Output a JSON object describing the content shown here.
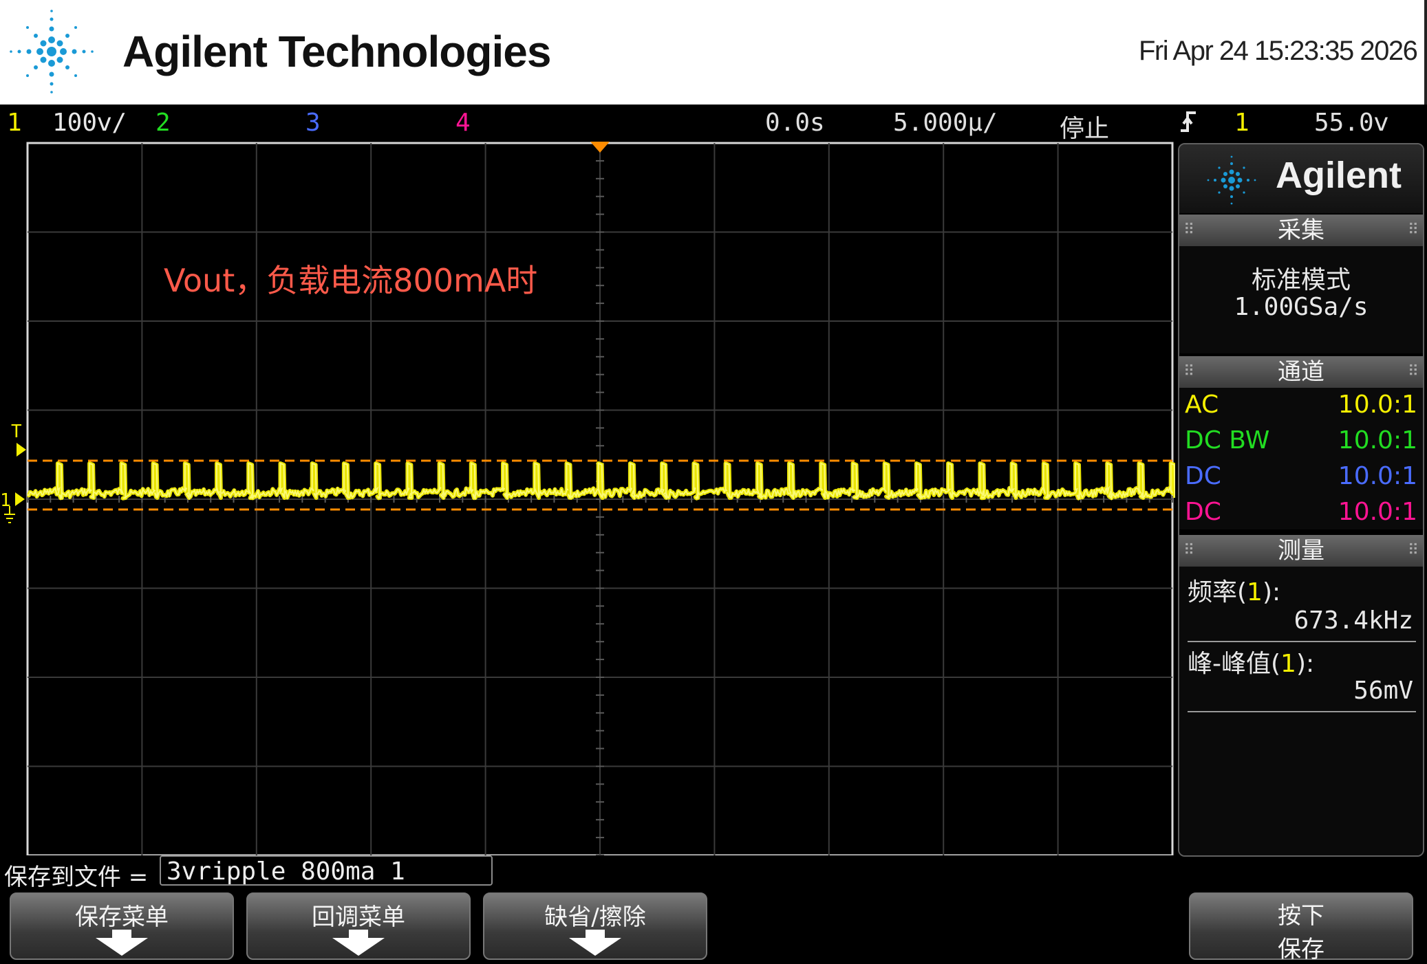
{
  "header": {
    "brand": "Agilent Technologies",
    "datetime": "Fri Apr 24 15:23:35 2026"
  },
  "status_bar": {
    "ch1_num": "1",
    "ch1_scale": "100ⅴ/",
    "ch2_num": "2",
    "ch3_num": "3",
    "ch4_num": "4",
    "delay": "0.0s",
    "timebase": "5.000µ/",
    "run_state": "停止",
    "trigger_icon": "rising-edge-trigger-icon",
    "trigger_source": "1",
    "trigger_level": "55.0ⅴ"
  },
  "screen": {
    "annotation": "Vout，负载电流800mA时",
    "trigger_marker_label": "T",
    "ground_marker_label": "1"
  },
  "panel": {
    "logo_text": "Agilent",
    "acquire": {
      "title": "采集",
      "mode": "标准模式",
      "rate": "1.00GSa/s"
    },
    "channels": {
      "title": "通道",
      "rows": [
        {
          "coupling": "AC",
          "probe": "10.0:1",
          "color": "#f5f000"
        },
        {
          "coupling": "DC BW",
          "probe": "10.0:1",
          "color": "#22dd22"
        },
        {
          "coupling": "DC",
          "probe": "10.0:1",
          "color": "#4a6cff"
        },
        {
          "coupling": "DC",
          "probe": "10.0:1",
          "color": "#ff1493"
        }
      ]
    },
    "measure": {
      "title": "测量",
      "m1_label_pre": "频率(",
      "m1_ch": "1",
      "m1_label_post": "):",
      "m1_value": "673.4kHz",
      "m2_label_pre": "峰-峰值(",
      "m2_ch": "1",
      "m2_label_post": "):",
      "m2_value": "56mV"
    }
  },
  "bottom": {
    "save_label": "保存到文件 =",
    "save_filename": "3vripple_800ma_1",
    "softkeys": [
      "保存菜单",
      "回调菜单",
      "缺省/擦除"
    ],
    "press_key_line1": "按下",
    "press_key_line2": "保存"
  },
  "colors": {
    "ch1": "#f5f000",
    "ch2": "#22dd22",
    "ch3": "#4a6cff",
    "ch4": "#ff1493",
    "cursor": "#ff8c00",
    "annotation": "#ff5a4a"
  },
  "trace": {
    "pulse_count": 36
  }
}
